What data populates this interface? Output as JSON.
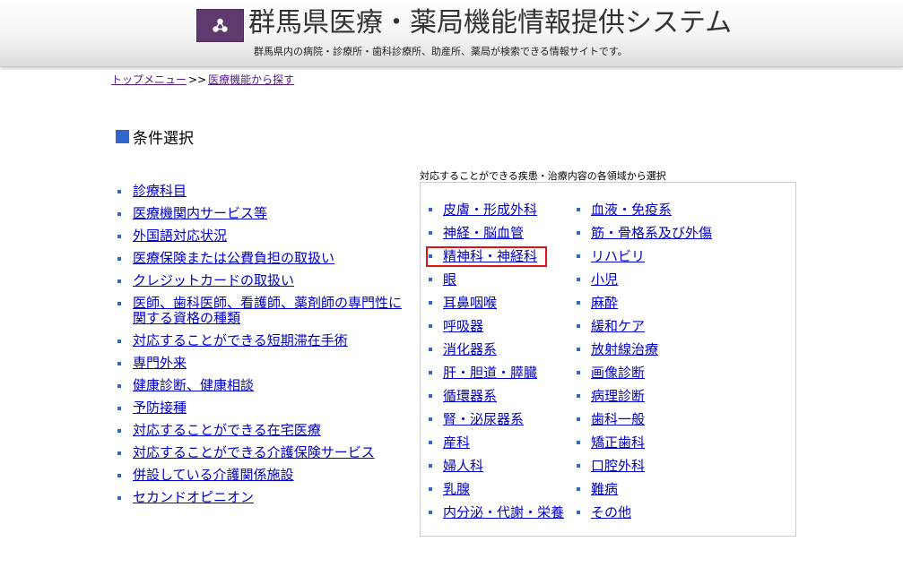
{
  "header": {
    "title": "群馬県医療・薬局機能情報提供システム",
    "subtitle": "群馬県内の病院・診療所・歯科診療所、助産所、薬局が検索できる情報サイトです。"
  },
  "breadcrumb": {
    "items": [
      "トップメニュー",
      "医療機能から探す"
    ],
    "separator": ">>"
  },
  "section": {
    "title": "条件選択"
  },
  "left_list": [
    "診療科目",
    "医療機関内サービス等",
    "外国語対応状況",
    "医療保険または公費負担の取扱い",
    "クレジットカードの取扱い",
    "医師、歯科医師、看護師、薬剤師の専門性に関する資格の種類",
    "対応することができる短期滞在手術",
    "専門外来",
    "健康診断、健康相談",
    "予防接種",
    "対応することができる在宅医療",
    "対応することができる介護保険サービス",
    "併設している介護関係施設",
    "セカンドオピニオン"
  ],
  "panel": {
    "caption": "対応することができる疾患・治療内容の各領域から選択",
    "col1": [
      "皮膚・形成外科",
      "神経・脳血管",
      "精神科・神経科",
      "眼",
      "耳鼻咽喉",
      "呼吸器",
      "消化器系",
      "肝・胆道・膵臓",
      "循環器系",
      "腎・泌尿器系",
      "産科",
      "婦人科",
      "乳腺",
      "内分泌・代謝・栄養"
    ],
    "col2": [
      "血液・免疫系",
      "筋・骨格系及び外傷",
      "リハビリ",
      "小児",
      "麻酔",
      "緩和ケア",
      "放射線治療",
      "画像診断",
      "病理診断",
      "歯科一般",
      "矯正歯科",
      "口腔外科",
      "難病",
      "その他"
    ]
  },
  "colors": {
    "accent": "#3366cc",
    "link": "#0000cc",
    "visited": "#551a8b",
    "highlight": "#e01414",
    "logo_bg": "#5e3a6e"
  }
}
